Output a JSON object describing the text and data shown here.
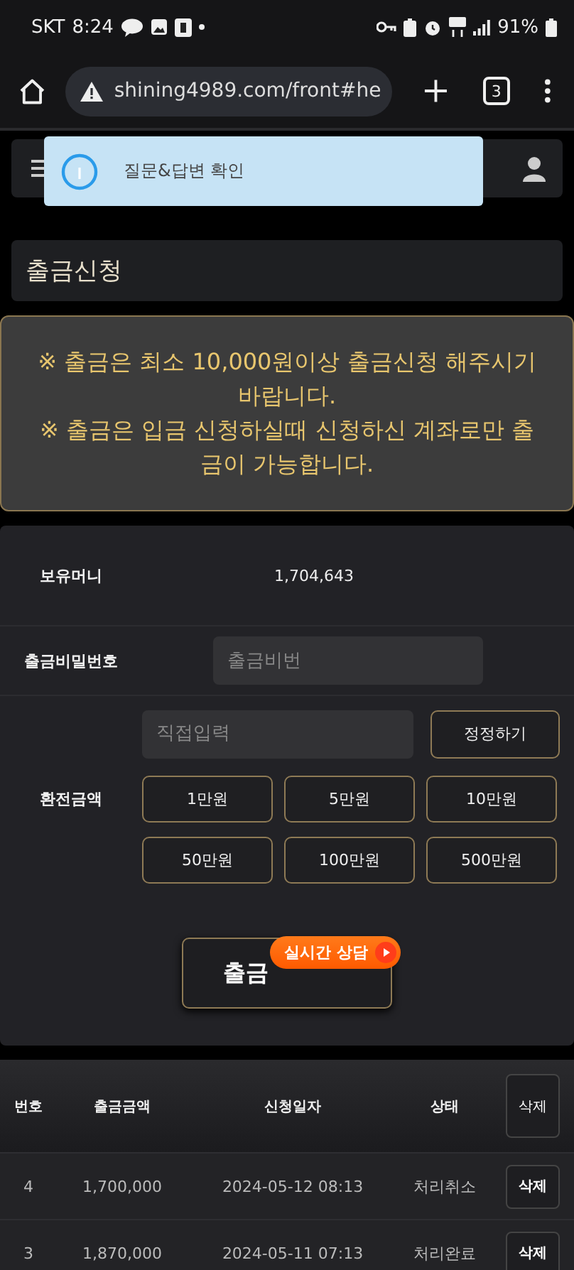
{
  "status_bar": {
    "carrier": "SKT",
    "time": "8:24",
    "battery": "91%"
  },
  "browser": {
    "url": "shining4989.com/front#he",
    "tab_count": "3"
  },
  "toast": {
    "message": "질문&답변 확인"
  },
  "page_title": "출금신청",
  "notice": [
    "※ 출금은 최소 10,000원이상 출금신청 해주시기 바랍니다.",
    "※ 출금은 입금 신청하실때 신청하신 계좌로만 출금이 가능합니다."
  ],
  "form": {
    "balance_label": "보유머니",
    "balance": "1,704,643",
    "password_label": "출금비밀번호",
    "password_placeholder": "출금비번",
    "amount_label": "환전금액",
    "amount_placeholder": "직접입력",
    "reset_button": "정정하기",
    "amount_buttons": [
      "1만원",
      "5만원",
      "10만원",
      "50만원",
      "100만원",
      "500만원"
    ],
    "submit_button": "출금"
  },
  "chat_badge": {
    "label": "실시간 상담"
  },
  "table": {
    "columns": [
      "번호",
      "출금금액",
      "신청일자",
      "상태"
    ],
    "delete_all": "삭제",
    "rows": [
      {
        "no": "4",
        "amount": "1,700,000",
        "date": "2024-05-12 08:13",
        "status": "처리취소",
        "delete": "삭제"
      },
      {
        "no": "3",
        "amount": "1,870,000",
        "date": "2024-05-11 07:13",
        "status": "처리완료",
        "delete": "삭제"
      }
    ]
  }
}
